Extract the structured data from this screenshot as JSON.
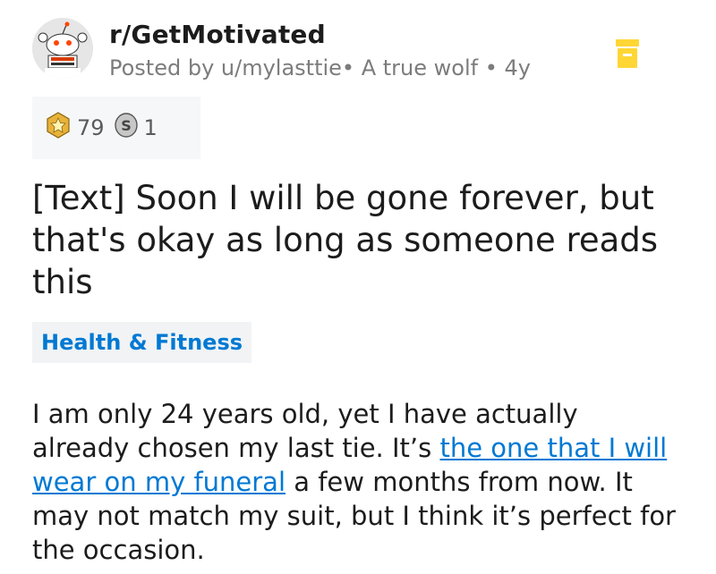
{
  "post": {
    "subreddit": "r/GetMotivated",
    "posted_prefix": "Posted by u/mylasttie",
    "user_flair": "• A true wolf",
    "separator": " • ",
    "age": "4y",
    "awards": [
      {
        "icon": "gold-award-icon",
        "count": "79"
      },
      {
        "icon": "silver-coin-icon",
        "count": "1"
      }
    ],
    "title": "[Text] Soon I will be gone forever, but that's okay as long as someone reads this",
    "flair": "Health & Fitness",
    "body_before": "I am only 24 years old, yet I have actually already chosen my last tie. It’s ",
    "body_link": "the one that I will wear on my funeral",
    "body_after": " a few months from now. It may not match my suit, but I think it’s perfect for the occasion."
  },
  "icons": {
    "avatar": "snoo-avatar-icon",
    "save": "save-icon"
  },
  "colors": {
    "accent": "#0079d3",
    "save": "#ffd635",
    "meta": "#7c7c7c"
  }
}
